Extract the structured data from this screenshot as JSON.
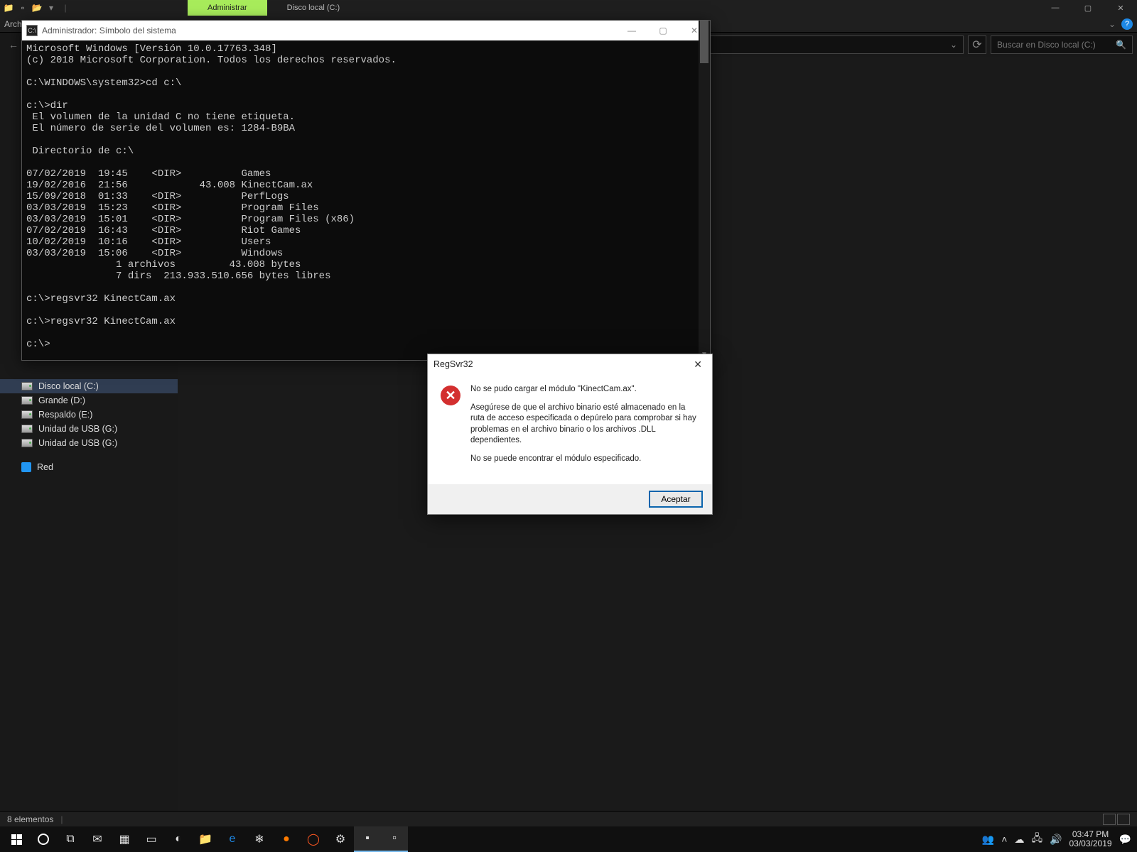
{
  "explorer": {
    "ribbon_tab_active": "Administrar",
    "ribbon_tab_title": "Disco local (C:)",
    "menu": {
      "file": "Archivo"
    },
    "address": "",
    "search_placeholder": "Buscar en Disco local (C:)",
    "nav_items": [
      {
        "label": "Disco local (C:)",
        "selected": true
      },
      {
        "label": "Grande (D:)"
      },
      {
        "label": "Respaldo (E:)"
      },
      {
        "label": "Unidad de USB (G:)"
      },
      {
        "label": "Unidad de USB (G:)"
      },
      {
        "label": "Red",
        "net": true
      }
    ],
    "status": "8 elementos"
  },
  "cmd": {
    "title": "Administrador: Símbolo del sistema",
    "output": "Microsoft Windows [Versión 10.0.17763.348]\n(c) 2018 Microsoft Corporation. Todos los derechos reservados.\n\nC:\\WINDOWS\\system32>cd c:\\\n\nc:\\>dir\n El volumen de la unidad C no tiene etiqueta.\n El número de serie del volumen es: 1284-B9BA\n\n Directorio de c:\\\n\n07/02/2019  19:45    <DIR>          Games\n19/02/2016  21:56            43.008 KinectCam.ax\n15/09/2018  01:33    <DIR>          PerfLogs\n03/03/2019  15:23    <DIR>          Program Files\n03/03/2019  15:01    <DIR>          Program Files (x86)\n07/02/2019  16:43    <DIR>          Riot Games\n10/02/2019  10:16    <DIR>          Users\n03/03/2019  15:06    <DIR>          Windows\n               1 archivos         43.008 bytes\n               7 dirs  213.933.510.656 bytes libres\n\nc:\\>regsvr32 KinectCam.ax\n\nc:\\>regsvr32 KinectCam.ax\n\nc:\\>"
  },
  "dialog": {
    "title": "RegSvr32",
    "line1": "No se pudo cargar el módulo \"KinectCam.ax\".",
    "line2": "Asegúrese de que el archivo binario esté almacenado en la ruta de acceso especificada o depúrelo para comprobar si hay problemas en el archivo binario o los archivos .DLL dependientes.",
    "line3": "No se puede encontrar el módulo especificado.",
    "ok": "Aceptar"
  },
  "taskbar": {
    "time": "03:47 PM",
    "date": "03/03/2019"
  }
}
